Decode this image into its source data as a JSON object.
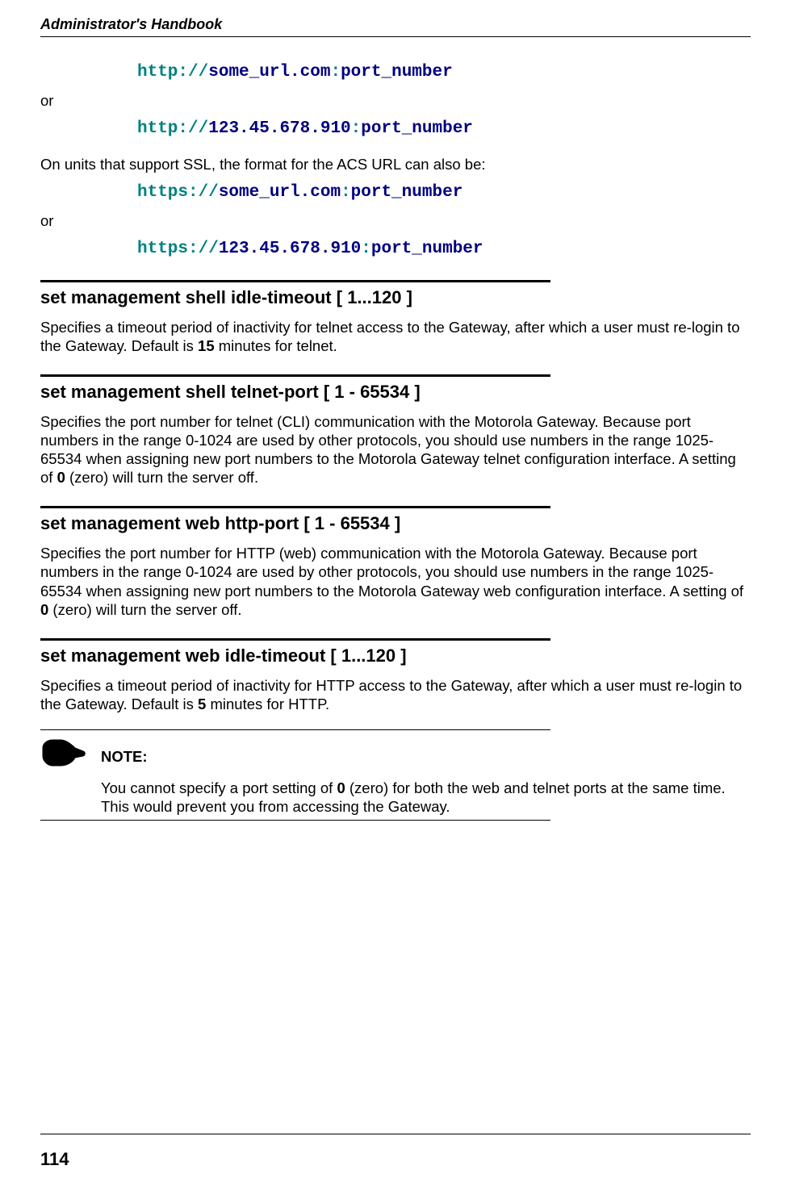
{
  "header": {
    "title": "Administrator's Handbook"
  },
  "code": {
    "p1": "http",
    "p2": "://",
    "p3": "some_url.com",
    "p4": ":",
    "p5": "port_number",
    "ip1": "http",
    "ip2": "://",
    "ip3": "123.45.678.910",
    "ip4": ":",
    "ip5": "port_number",
    "s1": "https",
    "s2": "://",
    "s3": "some_url.com",
    "s4": ":",
    "s5": "port_number",
    "sip1": "https",
    "sip2": "://",
    "sip3": "123.45.678.910",
    "sip4": ":",
    "sip5": "port_number"
  },
  "text": {
    "or1": "or",
    "ssl_intro": "On units that support SSL, the format for the ACS URL can also be:",
    "or2": "or"
  },
  "sections": {
    "s1": {
      "heading": "set management shell idle-timeout [ 1...120 ]",
      "body_a": "Specifies a timeout period of inactivity for telnet access to the Gateway, after which a user must re-login to the Gateway. Default is ",
      "body_b": "15",
      "body_c": " minutes for telnet."
    },
    "s2": {
      "heading": "set management shell telnet-port [ 1 - 65534 ]",
      "body_a": "Specifies the port number for telnet (CLI) communication with the Motorola Gateway. Because port numbers in the range 0-1024 are used by other protocols, you should use numbers in the range 1025-65534 when assigning new port numbers to the Motorola Gateway telnet configuration interface. A setting of ",
      "body_b": "0",
      "body_c": " (zero) will turn the server off."
    },
    "s3": {
      "heading": "set management web http-port [ 1 - 65534 ]",
      "body_a": "Specifies the port number for HTTP (web) communication with the Motorola Gateway. Because port numbers in the range 0-1024 are used by other protocols, you should use numbers in the range 1025-65534 when assigning new port numbers to the Motorola Gateway web configuration interface. A setting of ",
      "body_b": "0",
      "body_c": " (zero) will turn the server off."
    },
    "s4": {
      "heading": "set management web idle-timeout [ 1...120 ]",
      "body_a": "Specifies a timeout period of inactivity for HTTP access to the Gateway, after which a user must re-login to the Gateway. Default is ",
      "body_b": "5",
      "body_c": " minutes for HTTP."
    }
  },
  "note": {
    "label": "NOTE:",
    "body_a": "You cannot specify a port setting of ",
    "body_b": "0",
    "body_c": " (zero) for both the web and telnet ports at the same time. This would prevent you from accessing the Gateway."
  },
  "page_number": "114"
}
